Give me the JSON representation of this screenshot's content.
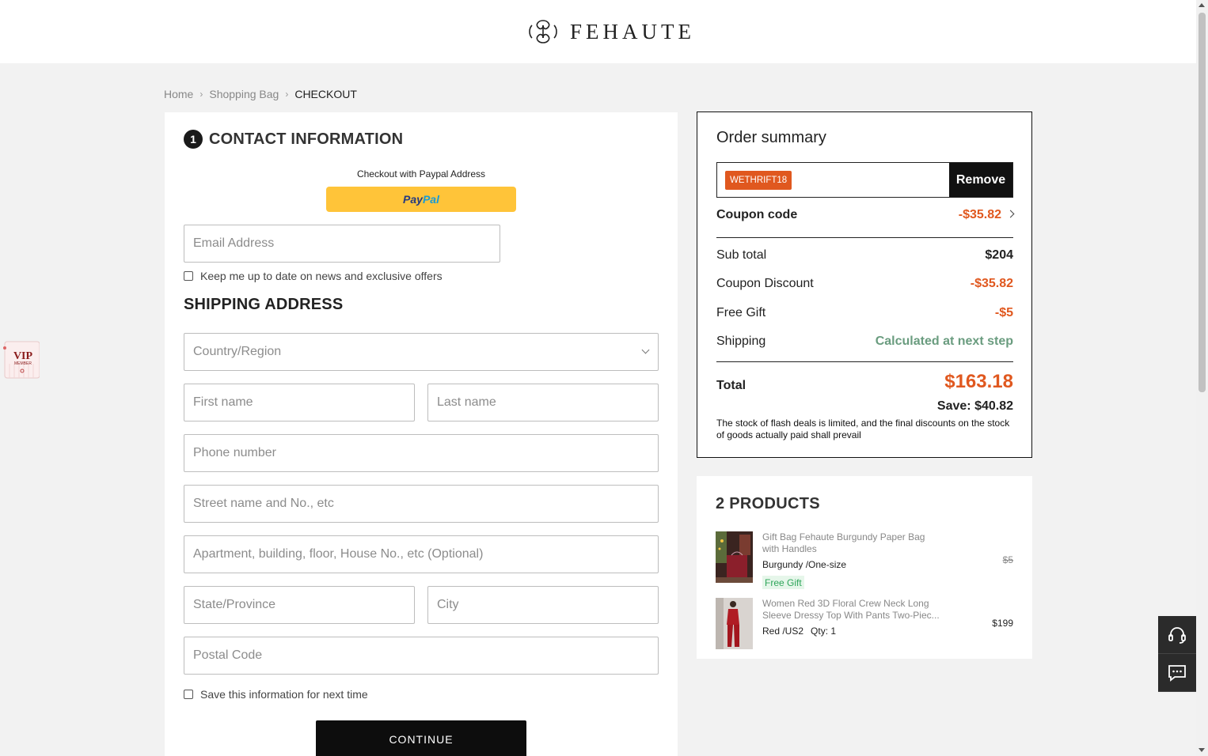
{
  "brand": {
    "name": "FEHAUTE"
  },
  "breadcrumb": {
    "home": "Home",
    "bag": "Shopping Bag",
    "current": "CHECKOUT"
  },
  "contact": {
    "step_number": "1",
    "title": "CONTACT INFORMATION",
    "paypal_label": "Checkout with Paypal Address",
    "paypal_pay": "Pay",
    "paypal_pal": "Pal",
    "email_placeholder": "Email Address",
    "newsletter_label": "Keep me up to date on news and exclusive offers"
  },
  "shipping": {
    "title": "SHIPPING ADDRESS",
    "country_placeholder": "Country/Region",
    "first_name_placeholder": "First name",
    "last_name_placeholder": "Last name",
    "phone_placeholder": "Phone number",
    "street_placeholder": "Street name and No., etc",
    "apartment_placeholder": "Apartment, building, floor, House No., etc (Optional)",
    "state_placeholder": "State/Province",
    "city_placeholder": "City",
    "postal_placeholder": "Postal Code",
    "save_info_label": "Save this information for next time",
    "continue_label": "CONTINUE"
  },
  "summary": {
    "title": "Order summary",
    "coupon_tag": "WETHRIFT18",
    "remove_label": "Remove",
    "coupon_code_label": "Coupon code",
    "coupon_code_value": "-$35.82",
    "subtotal_label": "Sub total",
    "subtotal_value": "$204",
    "coupon_discount_label": "Coupon Discount",
    "coupon_discount_value": "-$35.82",
    "free_gift_label": "Free Gift",
    "free_gift_value": "-$5",
    "shipping_label": "Shipping",
    "shipping_value": "Calculated at next step",
    "total_label": "Total",
    "total_value": "$163.18",
    "save_text": "Save: $40.82",
    "note": "The stock of flash deals is limited, and the final discounts on the stock of goods actually paid shall prevail"
  },
  "products": {
    "title": "2 PRODUCTS",
    "items": [
      {
        "name": "Gift Bag Fehaute Burgundy Paper Bag with Handles",
        "variant": "Burgundy /One-size",
        "badge": "Free Gift",
        "price": "$5"
      },
      {
        "name": "Women Red 3D Floral Crew Neck Long Sleeve Dressy Top With Pants Two-Piec...",
        "variant": "Red /US2",
        "qty": "Qty: 1",
        "price": "$199"
      }
    ]
  },
  "colors": {
    "accent_orange": "#e0581f",
    "shipping_green": "#6a9c7f",
    "paypal_yellow": "#ffc439"
  }
}
